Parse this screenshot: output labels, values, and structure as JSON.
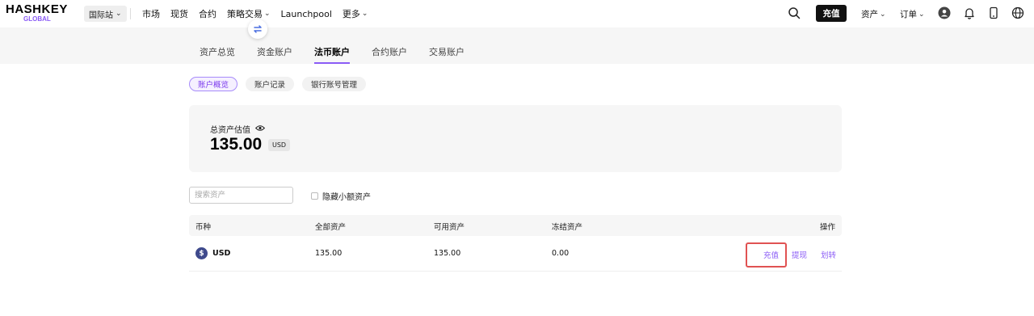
{
  "brand": {
    "logo_main": "HASHKEY",
    "logo_sub": "GLOBAL",
    "accent": "#8b5cf6"
  },
  "nav": {
    "site_selector": "国际站",
    "links": [
      {
        "label": "市场",
        "has_chevron": false
      },
      {
        "label": "现货",
        "has_chevron": false
      },
      {
        "label": "合约",
        "has_chevron": false
      },
      {
        "label": "策略交易",
        "has_chevron": true
      },
      {
        "label": "Launchpool",
        "has_chevron": false
      },
      {
        "label": "更多",
        "has_chevron": true
      }
    ],
    "deposit_label": "充值",
    "assets_menu": "资产",
    "orders_menu": "订单",
    "icons": [
      "search-icon",
      "user-icon",
      "bell-icon",
      "phone-icon",
      "globe-icon"
    ]
  },
  "tabs": {
    "items": [
      "资产总览",
      "资金账户",
      "法币账户",
      "合约账户",
      "交易账户"
    ],
    "active_index": 2
  },
  "subtabs": {
    "items": [
      "账户概览",
      "账户记录",
      "银行账号管理"
    ],
    "active_index": 0
  },
  "summary": {
    "label": "总资产估值",
    "value": "135.00",
    "unit": "USD"
  },
  "filter": {
    "search_placeholder": "搜索资产",
    "hide_small_label": "隐藏小额资产"
  },
  "table": {
    "headers": {
      "coin": "币种",
      "total": "全部资产",
      "available": "可用资产",
      "frozen": "冻结资产",
      "actions": "操作"
    },
    "rows": [
      {
        "coin_symbol": "$",
        "coin": "USD",
        "total": "135.00",
        "available": "135.00",
        "frozen": "0.00",
        "actions": [
          "充值",
          "提现",
          "划转"
        ]
      }
    ]
  }
}
